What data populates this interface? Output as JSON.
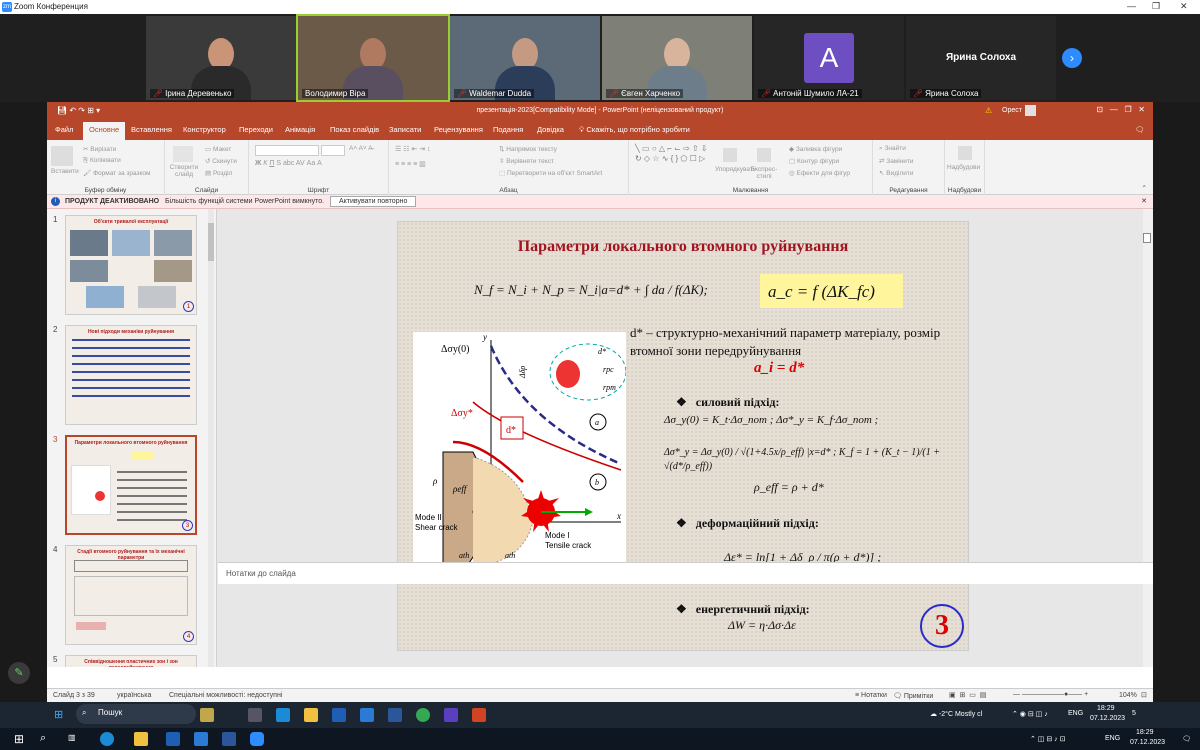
{
  "zoom": {
    "title": "Zoom Конференция",
    "participants": [
      {
        "name": "Ірина Деревенько",
        "muted": true
      },
      {
        "name": "Володимир Віра",
        "muted": false
      },
      {
        "name": "Waldemar Dudda",
        "muted": true
      },
      {
        "name": "Євген Харченко",
        "muted": true
      },
      {
        "name": "Антоній Шумило ЛА-21",
        "muted": true,
        "avatar_letter": "A"
      },
      {
        "name": "Ярина Солоха",
        "muted": true,
        "big_label": "Ярина Солоха"
      }
    ]
  },
  "ppt": {
    "window_title": "презентація-2023[Compatibility Mode] - PowerPoint (неліцензований продукт)",
    "user": "Орест",
    "warning_icon": "warning-icon",
    "tabs": [
      "Файл",
      "Основне",
      "Вставлення",
      "Конструктор",
      "Переходи",
      "Анімація",
      "Показ слайдів",
      "Записати",
      "Рецензування",
      "Подання",
      "Довідка"
    ],
    "tell_me": "Скажіть, що потрібно зробити",
    "ribbon": {
      "clipboard": {
        "label": "Буфер обміну",
        "paste": "Вставити",
        "cut": "Вирізати",
        "copy": "Копіювати",
        "format": "Формат за зразком"
      },
      "slides": {
        "label": "Слайди",
        "new": "Створити слайд",
        "layout": "Макет",
        "reset": "Скинути",
        "section": "Розділ"
      },
      "font": {
        "label": "Шрифт"
      },
      "paragraph": {
        "label": "Абзац",
        "direction": "Напрямок тексту",
        "align": "Вирівняти текст",
        "smartart": "Перетворити на об'єкт SmartArt"
      },
      "drawing": {
        "label": "Малювання",
        "arrange": "Упорядкувати",
        "styles": "Експрес-стилі",
        "fill": "Заливка фігури",
        "outline": "Контур фігури",
        "effects": "Ефекти для фігур"
      },
      "editing": {
        "label": "Редагування",
        "find": "Знайти",
        "replace": "Замінити",
        "select": "Виділити"
      },
      "voice": {
        "label": "Надбудови",
        "addins": "Надбудови"
      }
    },
    "infobar": {
      "bold": "ПРОДУКТ ДЕАКТИВОВАНО",
      "text": "Більшість функцій системи PowerPoint вимкнуто.",
      "button": "Активувати повторно"
    },
    "thumbnails": [
      {
        "num": "1",
        "title": "Об'єкти тривалої експлуатації"
      },
      {
        "num": "2",
        "title": "Нові підходи механіки руйнування"
      },
      {
        "num": "3",
        "title": "Параметри локального втомного руйнування"
      },
      {
        "num": "4",
        "title": "Стадії втомного руйнування та їх механічні параметри"
      },
      {
        "num": "5",
        "title": "Співвідношення пластичних зон і зон передруйнування"
      }
    ],
    "slide": {
      "title": "Параметри локального втомного руйнування",
      "formula_main": "N_f = N_i + N_p = N_i|a=d* + ∫ da / f(ΔK);",
      "formula_box": "a_c = f (ΔK_fc)",
      "dstar_text": "d* – структурно-механічний параметр матеріалу, розмір втомної зони передруйнування",
      "ai_eq": "a_i = d*",
      "approach1": "силовий підхід:",
      "eq1": "Δσ_y(0) = K_t·Δσ_nom ;    Δσ*_y = K_f·Δσ_nom ;",
      "eq2": "Δσ*_y = Δσ_y(0) / √(1+4.5x/ρ_eff) |x=d* ;   K_f = 1 + (K_t − 1)/(1 + √(d*/ρ_eff))",
      "eq3": "ρ_eff = ρ + d*",
      "approach2": "деформаційний підхід:",
      "eq4": "Δε* = ln[1 + Δδ_ρ / π(ρ + d*)] ;",
      "approach3": "енергетичний підхід:",
      "eq5": "ΔW = η·Δσ·Δε",
      "slide_number": "3",
      "figure": {
        "labels": [
          "Δσ_y(0)",
          "Δσ*_y",
          "d*",
          "ρ",
          "ρ_eff",
          "Mode II",
          "Shear crack",
          "Mode I",
          "Tensile crack",
          "a_th",
          "a_th",
          "a_c",
          "x",
          "y",
          "Δδ_ρ",
          "r_pc",
          "r_pm",
          "a",
          "b"
        ]
      }
    },
    "notes_placeholder": "Нотатки до слайда",
    "status": {
      "slide": "Слайд 3 з 39",
      "lang": "українська",
      "accessibility": "Спеціальні можливості: недоступні",
      "notes": "Нотатки",
      "comments": "Примітки",
      "zoom": "104%"
    }
  },
  "taskbar": {
    "search": "Пошук",
    "weather": "-2°C  Mostly cl",
    "lang": "ENG",
    "time": "18:29",
    "date": "07.12.2023",
    "notif_count": "5"
  }
}
